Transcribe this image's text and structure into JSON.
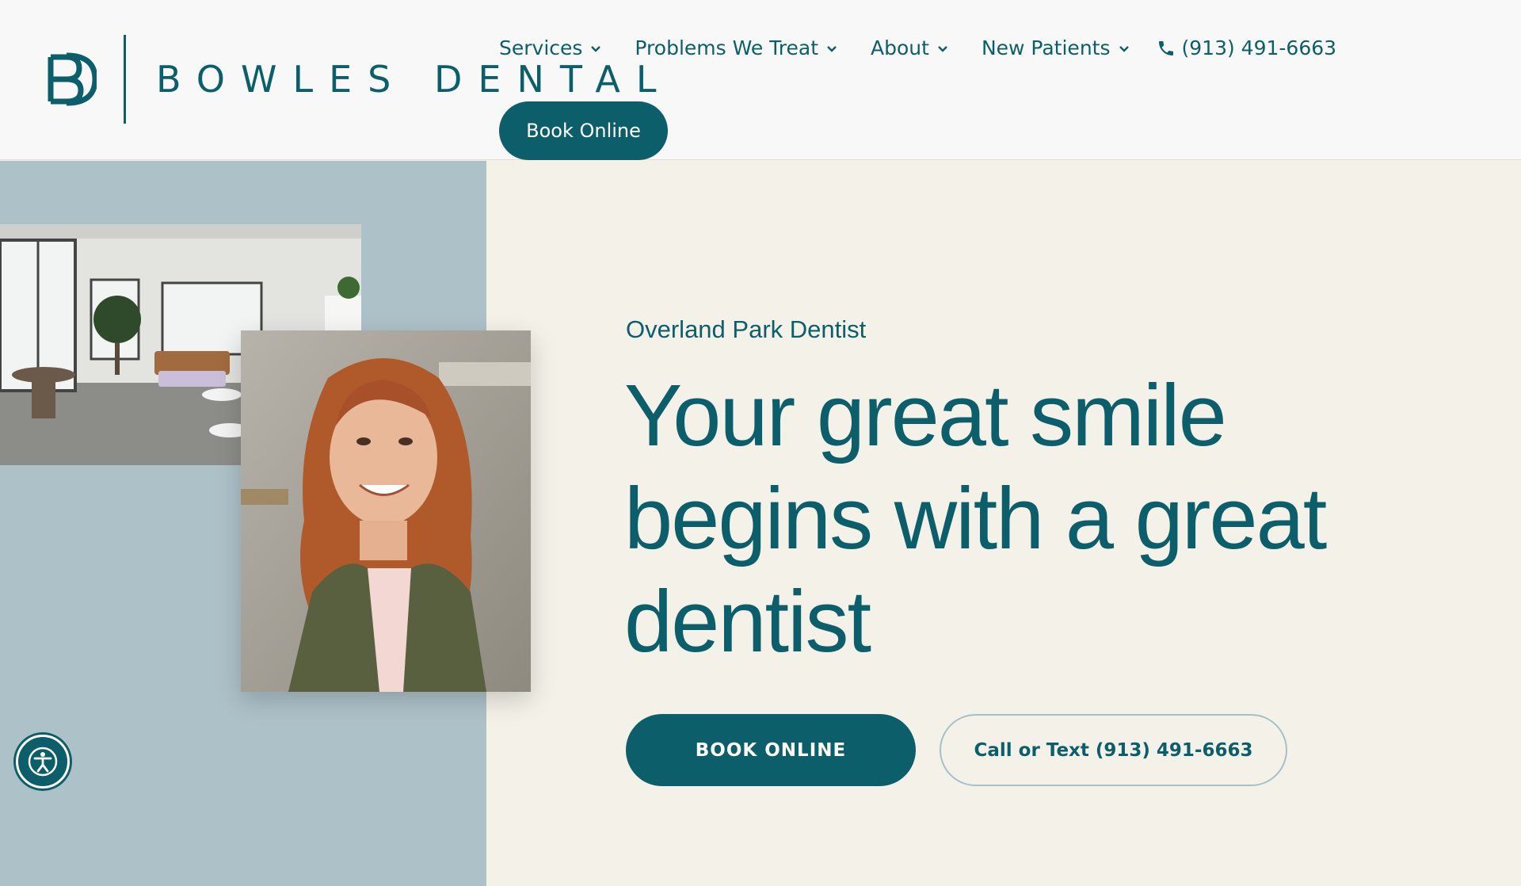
{
  "header": {
    "logo_text": "BOWLES DENTAL",
    "nav": [
      {
        "label": "Services"
      },
      {
        "label": "Problems We Treat"
      },
      {
        "label": "About"
      },
      {
        "label": "New Patients"
      }
    ],
    "phone": "(913) 491-6663",
    "book_label": "Book Online"
  },
  "hero": {
    "eyebrow": "Overland Park Dentist",
    "headline": "Your great smile begins with a great dentist",
    "primary_cta": "BOOK ONLINE",
    "secondary_cta": "Call or Text (913) 491-6663"
  },
  "colors": {
    "brand_teal": "#0d5e6b",
    "left_panel": "#adc1c8",
    "hero_bg": "#f4f1e8",
    "header_bg": "#f8f8f8"
  },
  "icons": {
    "logo": "bd-monogram-icon",
    "phone": "phone-icon",
    "chevron": "chevron-down-icon",
    "accessibility": "accessibility-icon"
  }
}
